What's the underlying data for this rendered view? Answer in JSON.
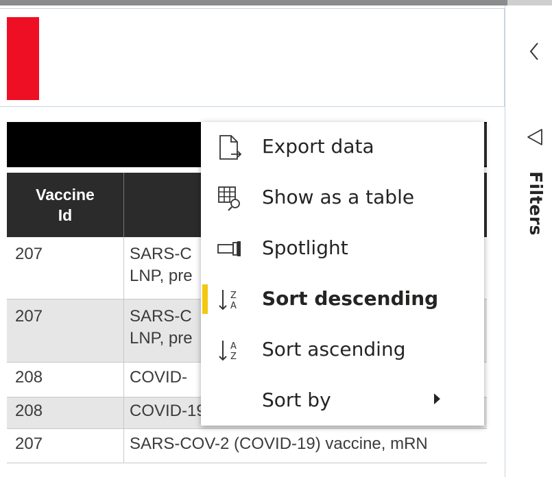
{
  "table": {
    "headers": {
      "vaccine_id": "Vaccine\nId",
      "description": ""
    },
    "rows": [
      {
        "id": "207",
        "desc": "SARS-C\nLNP, pre",
        "alt": false
      },
      {
        "id": "207",
        "desc": "SARS-C\nLNP, pre",
        "alt": true
      },
      {
        "id": "208",
        "desc": "COVID-",
        "alt": false
      },
      {
        "id": "208",
        "desc": "COVID-19, mRNA, LNP-S, PF, 30 mcg/",
        "alt": true
      },
      {
        "id": "207",
        "desc": "SARS-COV-2 (COVID-19) vaccine, mRN",
        "alt": false
      }
    ]
  },
  "context_menu": {
    "items": [
      {
        "label": "Export data",
        "icon": "export-data-icon"
      },
      {
        "label": "Show as a table",
        "icon": "show-as-table-icon"
      },
      {
        "label": "Spotlight",
        "icon": "spotlight-icon"
      },
      {
        "label": "Sort descending",
        "icon": "sort-descending-icon",
        "active": true
      },
      {
        "label": "Sort ascending",
        "icon": "sort-ascending-icon"
      },
      {
        "label": "Sort by",
        "icon": "",
        "submenu": true
      }
    ]
  },
  "filters_pane": {
    "label": "Filters"
  },
  "colors": {
    "accent": "#f2c811",
    "header_block": "#ee0f24",
    "table_header": "#2b2b2b"
  }
}
